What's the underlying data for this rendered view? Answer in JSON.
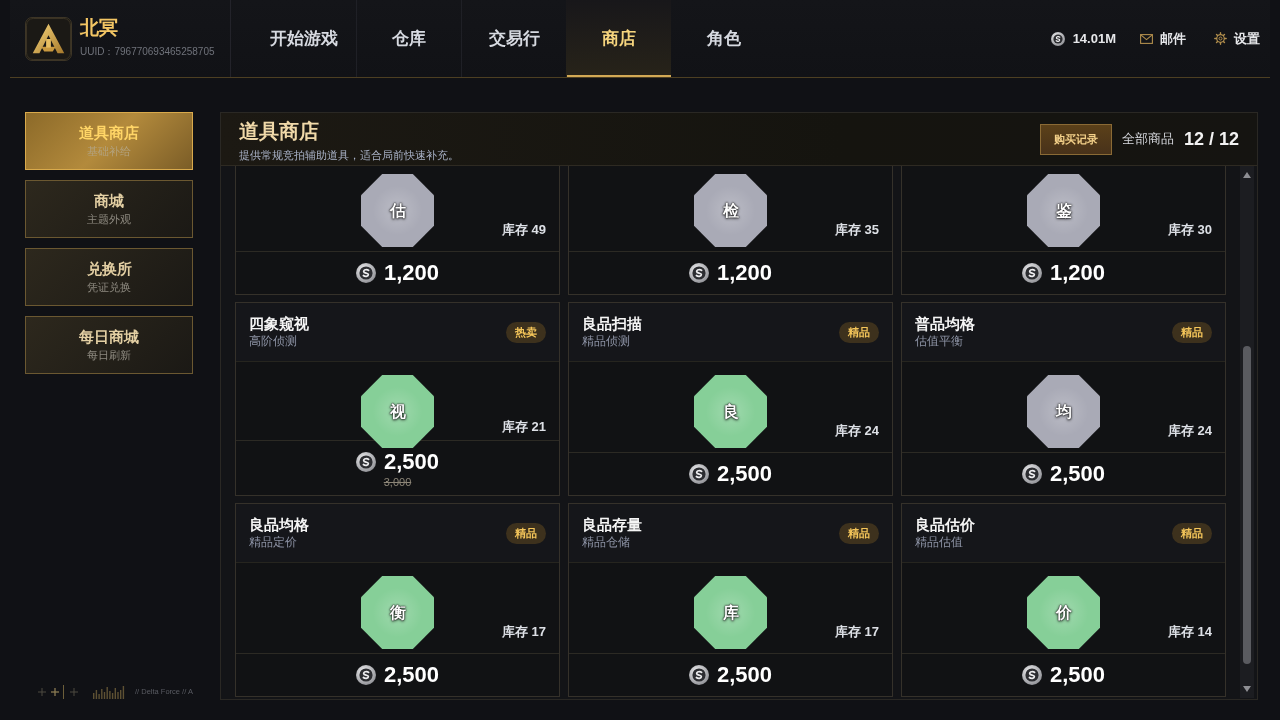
{
  "app": {
    "name": "北冥",
    "user_id": "UUID：796770693465258705"
  },
  "nav_tabs": [
    {
      "label": "开始游戏",
      "selected": false
    },
    {
      "label": "仓库",
      "selected": false
    },
    {
      "label": "交易行",
      "selected": false
    },
    {
      "label": "商店",
      "selected": true
    },
    {
      "label": "角色",
      "selected": false
    }
  ],
  "status": {
    "balance": "14.01M",
    "mail": "邮件",
    "settings": "设置"
  },
  "sidebar": {
    "items": [
      {
        "title": "道具商店",
        "subtitle": "基础补给",
        "selected": true
      },
      {
        "title": "商城",
        "subtitle": "主题外观",
        "selected": false
      },
      {
        "title": "兑换所",
        "subtitle": "凭证兑换",
        "selected": false
      },
      {
        "title": "每日商城",
        "subtitle": "每日刷新",
        "selected": false
      }
    ],
    "caption": "// Delta Force // A"
  },
  "shop": {
    "title": "道具商店",
    "description": "提供常规竞拍辅助道具，适合局前快速补充。",
    "history_button": "购买记录",
    "filter_label": "全部商品",
    "count": "12 / 12",
    "items": [
      {
        "emblem": "估",
        "color": "#a9aab6",
        "stock": "库存 49",
        "price": "1,200"
      },
      {
        "emblem": "检",
        "color": "#a9aab6",
        "stock": "库存 35",
        "price": "1,200"
      },
      {
        "emblem": "鉴",
        "color": "#a9aab6",
        "stock": "库存 30",
        "price": "1,200"
      },
      {
        "name": "四象窥视",
        "description": "高阶侦测",
        "tag": "热卖",
        "emblem": "视",
        "color": "#86cf98",
        "stock": "库存 21",
        "price": "2,500",
        "original_price": "3,000"
      },
      {
        "name": "良品扫描",
        "description": "精品侦测",
        "tag": "精品",
        "emblem": "良",
        "color": "#86cf98",
        "stock": "库存 24",
        "price": "2,500"
      },
      {
        "name": "普品均格",
        "description": "估值平衡",
        "tag": "精品",
        "emblem": "均",
        "color": "#a9aab6",
        "stock": "库存 24",
        "price": "2,500"
      },
      {
        "name": "良品均格",
        "description": "精品定价",
        "tag": "精品",
        "emblem": "衡",
        "color": "#86cf98",
        "stock": "库存 17",
        "price": "2,500"
      },
      {
        "name": "良品存量",
        "description": "精品仓储",
        "tag": "精品",
        "emblem": "库",
        "color": "#86cf98",
        "stock": "库存 17",
        "price": "2,500"
      },
      {
        "name": "良品估价",
        "description": "精品估值",
        "tag": "精品",
        "emblem": "价",
        "color": "#86cf98",
        "stock": "库存 14",
        "price": "2,500"
      }
    ]
  }
}
